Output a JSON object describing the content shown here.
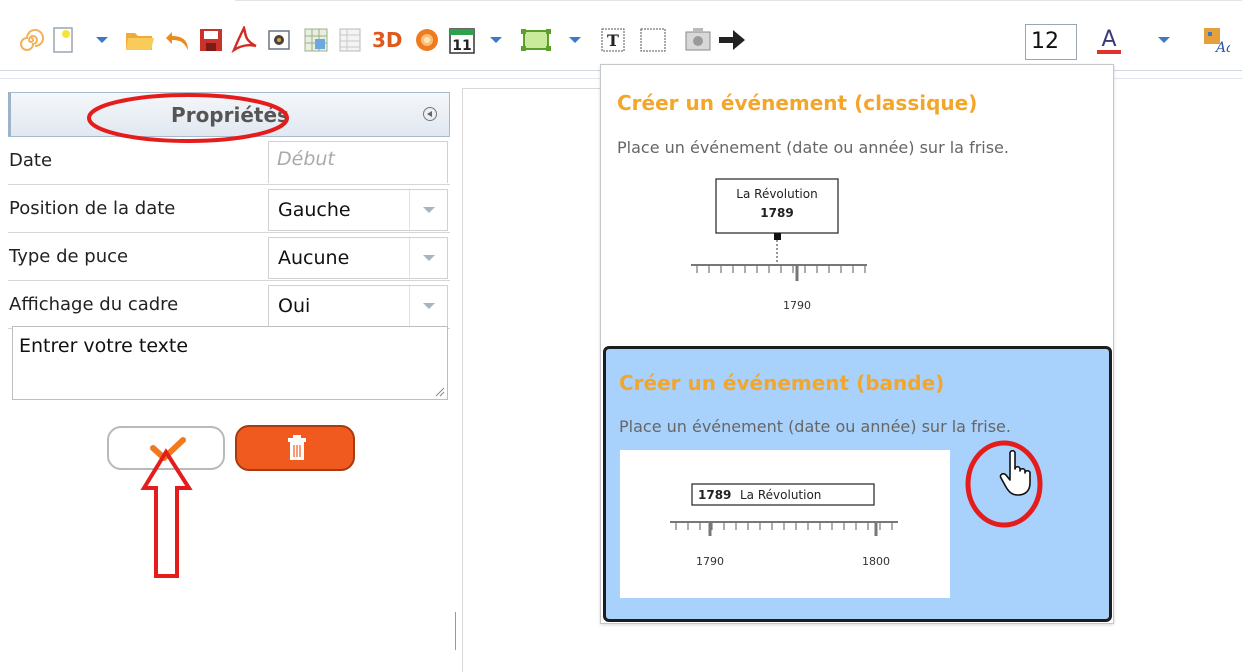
{
  "toolbar": {
    "items": [
      "spiral-icon",
      "new-page-icon",
      "chevron-down-icon",
      "open-folder-icon",
      "undo-icon",
      "save-icon",
      "pdf-icon",
      "image-export-icon",
      "grid-icon",
      "table-icon",
      "3d-label",
      "globe-icon",
      "calendar-icon",
      "chevron-down-icon",
      "frame-icon",
      "chevron-down-icon",
      "text-tool-icon",
      "rectangle-tool-icon",
      "camera-icon",
      "arrow-right-icon",
      "font-size-box",
      "font-color-icon",
      "chevron-down-icon",
      "text-style-icon"
    ],
    "three_d_label": "3D",
    "calendar_day": "11",
    "text_tool_glyph": "T",
    "font_size": "12",
    "font_color_glyph": "A",
    "font_color": "#e0312b"
  },
  "properties": {
    "title": "Propriétés",
    "date_label": "Date",
    "date_placeholder": "Début",
    "position_label": "Position de la date",
    "position_value": "Gauche",
    "bullet_label": "Type de puce",
    "bullet_value": "Aucune",
    "frame_label": "Affichage du cadre",
    "frame_value": "Oui",
    "text_value": "Entrer votre texte"
  },
  "dropdown": {
    "option1_title": "Créer un événement (classique)",
    "option1_desc": "Place un événement (date ou année) sur la frise.",
    "option1_box_line1": "La Révolution",
    "option1_box_line2": "1789",
    "option1_axis_label": "1790",
    "option2_title": "Créer un événement (bande)",
    "option2_desc": "Place un événement (date ou année) sur la frise.",
    "option2_box_year": "1789",
    "option2_box_text": "La Révolution",
    "option2_axis_label_1": "1790",
    "option2_axis_label_2": "1800"
  },
  "colors": {
    "accent_orange": "#f4a62a",
    "selected_bg": "#a8d1fb",
    "delete_red": "#f05a1f",
    "annotation_red": "#e51c1c"
  }
}
